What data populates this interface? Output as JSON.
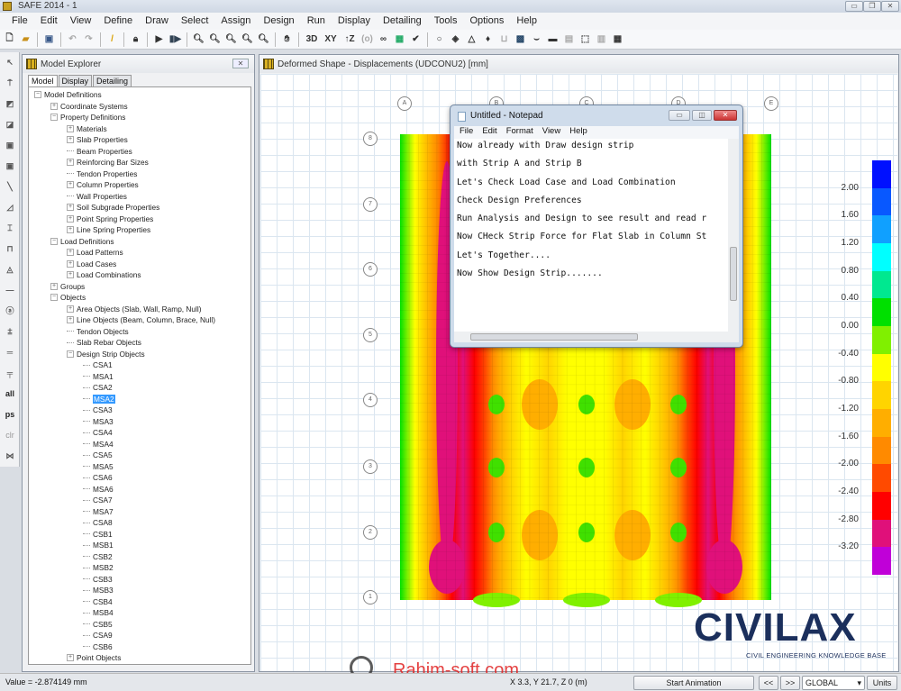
{
  "window": {
    "title": "SAFE 2014 - 1"
  },
  "menu": [
    "File",
    "Edit",
    "View",
    "Define",
    "Draw",
    "Select",
    "Assign",
    "Design",
    "Run",
    "Display",
    "Detailing",
    "Tools",
    "Options",
    "Help"
  ],
  "toolbar": {
    "view_3d": "3D",
    "view_xy": "XY",
    "view_z": "↑Z"
  },
  "left_tools": {
    "all": "all",
    "ps": "ps",
    "clr": "clr"
  },
  "explorer": {
    "title": "Model Explorer",
    "tabs": [
      "Model",
      "Display",
      "Detailing"
    ],
    "tree": [
      {
        "l": 0,
        "t": "-",
        "label": "Model Definitions"
      },
      {
        "l": 1,
        "t": "+",
        "label": "Coordinate Systems"
      },
      {
        "l": 1,
        "t": "-",
        "label": "Property Definitions"
      },
      {
        "l": 2,
        "t": "+",
        "label": "Materials"
      },
      {
        "l": 2,
        "t": "+",
        "label": "Slab Properties"
      },
      {
        "l": 2,
        "t": "",
        "label": "Beam Properties"
      },
      {
        "l": 2,
        "t": "+",
        "label": "Reinforcing Bar Sizes"
      },
      {
        "l": 2,
        "t": "",
        "label": "Tendon Properties"
      },
      {
        "l": 2,
        "t": "+",
        "label": "Column Properties"
      },
      {
        "l": 2,
        "t": "",
        "label": "Wall Properties"
      },
      {
        "l": 2,
        "t": "+",
        "label": "Soil Subgrade Properties"
      },
      {
        "l": 2,
        "t": "+",
        "label": "Point Spring Properties"
      },
      {
        "l": 2,
        "t": "+",
        "label": "Line Spring Properties"
      },
      {
        "l": 1,
        "t": "-",
        "label": "Load Definitions"
      },
      {
        "l": 2,
        "t": "+",
        "label": "Load Patterns"
      },
      {
        "l": 2,
        "t": "+",
        "label": "Load Cases"
      },
      {
        "l": 2,
        "t": "+",
        "label": "Load Combinations"
      },
      {
        "l": 1,
        "t": "+",
        "label": "Groups"
      },
      {
        "l": 1,
        "t": "-",
        "label": "Objects"
      },
      {
        "l": 2,
        "t": "+",
        "label": "Area Objects (Slab, Wall, Ramp, Null)"
      },
      {
        "l": 2,
        "t": "+",
        "label": "Line Objects (Beam, Column, Brace, Null)"
      },
      {
        "l": 2,
        "t": "",
        "label": "Tendon Objects"
      },
      {
        "l": 2,
        "t": "",
        "label": "Slab Rebar Objects"
      },
      {
        "l": 2,
        "t": "-",
        "label": "Design Strip Objects"
      },
      {
        "l": 3,
        "t": "",
        "label": "CSA1"
      },
      {
        "l": 3,
        "t": "",
        "label": "MSA1"
      },
      {
        "l": 3,
        "t": "",
        "label": "CSA2"
      },
      {
        "l": 3,
        "t": "",
        "label": "MSA2",
        "selected": true
      },
      {
        "l": 3,
        "t": "",
        "label": "CSA3"
      },
      {
        "l": 3,
        "t": "",
        "label": "MSA3"
      },
      {
        "l": 3,
        "t": "",
        "label": "CSA4"
      },
      {
        "l": 3,
        "t": "",
        "label": "MSA4"
      },
      {
        "l": 3,
        "t": "",
        "label": "CSA5"
      },
      {
        "l": 3,
        "t": "",
        "label": "MSA5"
      },
      {
        "l": 3,
        "t": "",
        "label": "CSA6"
      },
      {
        "l": 3,
        "t": "",
        "label": "MSA6"
      },
      {
        "l": 3,
        "t": "",
        "label": "CSA7"
      },
      {
        "l": 3,
        "t": "",
        "label": "MSA7"
      },
      {
        "l": 3,
        "t": "",
        "label": "CSA8"
      },
      {
        "l": 3,
        "t": "",
        "label": "CSB1"
      },
      {
        "l": 3,
        "t": "",
        "label": "MSB1"
      },
      {
        "l": 3,
        "t": "",
        "label": "CSB2"
      },
      {
        "l": 3,
        "t": "",
        "label": "MSB2"
      },
      {
        "l": 3,
        "t": "",
        "label": "CSB3"
      },
      {
        "l": 3,
        "t": "",
        "label": "MSB3"
      },
      {
        "l": 3,
        "t": "",
        "label": "CSB4"
      },
      {
        "l": 3,
        "t": "",
        "label": "MSB4"
      },
      {
        "l": 3,
        "t": "",
        "label": "CSB5"
      },
      {
        "l": 3,
        "t": "",
        "label": "CSA9"
      },
      {
        "l": 3,
        "t": "",
        "label": "CSB6"
      },
      {
        "l": 2,
        "t": "+",
        "label": "Point Objects"
      }
    ]
  },
  "viewport": {
    "title": "Deformed Shape - Displacements (UDCONU2)  [mm]",
    "grid_x": [
      "A",
      "B",
      "C",
      "D",
      "E"
    ],
    "grid_y": [
      "8",
      "7",
      "6",
      "5",
      "4",
      "3",
      "2",
      "1"
    ]
  },
  "legend": {
    "values": [
      "2.00",
      "1.60",
      "1.20",
      "0.80",
      "0.40",
      "0.00",
      "-0.40",
      "-0.80",
      "-1.20",
      "-1.60",
      "-2.00",
      "-2.40",
      "-2.80",
      "-3.20"
    ],
    "colors": [
      "#0010ff",
      "#0858ff",
      "#10a0ff",
      "#00ffff",
      "#00e890",
      "#00e000",
      "#80f000",
      "#ffff00",
      "#ffd400",
      "#ffae00",
      "#ff8a00",
      "#ff4a00",
      "#ff0000",
      "#e0107a",
      "#c000d8"
    ]
  },
  "notepad": {
    "title": "Untitled - Notepad",
    "menu": [
      "File",
      "Edit",
      "Format",
      "View",
      "Help"
    ],
    "lines": [
      "Now already with Draw design strip",
      "with Strip A and Strip B",
      "Let's Check Load Case and Load Combination",
      "Check Design Preferences",
      "Run Analysis and Design to see result and read r",
      "Now CHeck Strip Force for Flat Slab in Column St",
      "Let's Together....",
      "Now Show Design Strip......."
    ]
  },
  "status": {
    "value": "Value = -2.874149 mm",
    "coords": "X 3.3, Y 21.7, Z 0  (m)",
    "start_animation": "Start Animation",
    "prev": "<<",
    "next": ">>",
    "coord_system": "GLOBAL",
    "units": "Units"
  },
  "watermarks": {
    "logo": "CIVILAX",
    "logo_sub": "CIVIL ENGINEERING KNOWLEDGE BASE",
    "site": "Rahim-soft.com"
  }
}
